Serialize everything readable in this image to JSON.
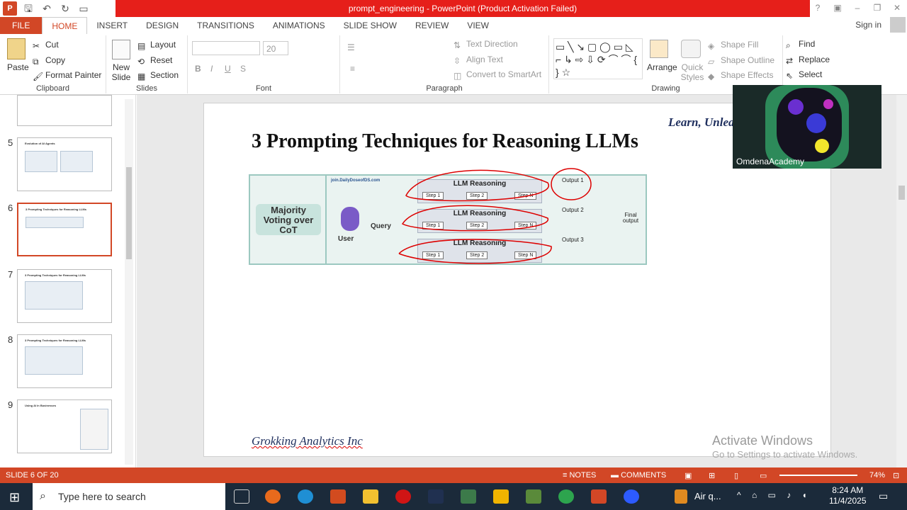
{
  "window": {
    "title": "prompt_engineering - PowerPoint (Product Activation Failed)"
  },
  "ribbon": {
    "tabs": [
      "FILE",
      "HOME",
      "INSERT",
      "DESIGN",
      "TRANSITIONS",
      "ANIMATIONS",
      "SLIDE SHOW",
      "REVIEW",
      "VIEW"
    ],
    "sign_in": "Sign in",
    "clipboard": {
      "paste": "Paste",
      "cut": "Cut",
      "copy": "Copy",
      "format_painter": "Format Painter",
      "label": "Clipboard"
    },
    "slides": {
      "new_slide": "New Slide",
      "layout": "Layout",
      "reset": "Reset",
      "section": "Section",
      "label": "Slides"
    },
    "font": {
      "size": "20",
      "label": "Font"
    },
    "paragraph": {
      "text_direction": "Text Direction",
      "align_text": "Align Text",
      "convert_smartart": "Convert to SmartArt",
      "label": "Paragraph"
    },
    "drawing": {
      "arrange": "Arrange",
      "quick_styles": "Quick Styles",
      "shape_fill": "Shape Fill",
      "shape_outline": "Shape Outline",
      "shape_effects": "Shape Effects",
      "label": "Drawing"
    },
    "editing": {
      "find": "Find",
      "replace": "Replace",
      "select": "Select"
    }
  },
  "thumbnails": [
    {
      "num": "5",
      "title": "Evolution of AI Agents"
    },
    {
      "num": "6",
      "title": "3 Prompting Techniques for Reasoning LLMs"
    },
    {
      "num": "7",
      "title": "3 Prompting Techniques for Reasoning LLMs"
    },
    {
      "num": "8",
      "title": "3 Prompting Techniques for Reasoning LLMs"
    },
    {
      "num": "9",
      "title": "Using AI in Businesses"
    }
  ],
  "slide": {
    "title": "3 Prompting Techniques for Reasoning LLMs",
    "tagline": "Learn, Unlea",
    "footer": "Grokking Analytics Inc",
    "diagram": {
      "method": "Majority Voting over CoT",
      "user": "User",
      "query": "Query",
      "source": "join.DailyDoseofDS.com",
      "llm_label": "LLM Reasoning",
      "steps": [
        "Step 1",
        "Step 2",
        "Step N"
      ],
      "outputs": [
        "Output 1",
        "Output 2",
        "Output 3"
      ],
      "final": "Final output"
    }
  },
  "webcam": {
    "name": "OmdenaAcademy"
  },
  "watermark": {
    "line1": "Activate Windows",
    "line2": "Go to Settings to activate Windows."
  },
  "status": {
    "slide": "SLIDE 6 OF 20",
    "notes": "NOTES",
    "comments": "COMMENTS",
    "zoom": "74%"
  },
  "taskbar": {
    "search": "Type here to search",
    "weather": "Air q...",
    "time": "8:24 AM",
    "date": "11/4/2025"
  }
}
